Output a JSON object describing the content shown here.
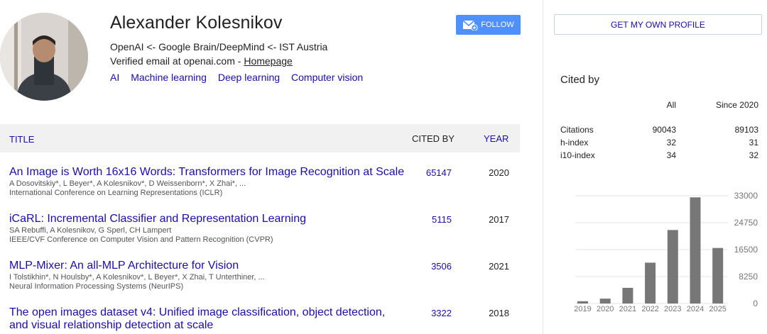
{
  "profile": {
    "name": "Alexander Kolesnikov",
    "affiliation": "OpenAI <- Google Brain/DeepMind <- IST Austria",
    "email_prefix": "Verified email at openai.com - ",
    "homepage_label": "Homepage",
    "interests": [
      "AI",
      "Machine learning",
      "Deep learning",
      "Computer vision"
    ],
    "follow_label": "FOLLOW"
  },
  "table": {
    "headers": {
      "title": "TITLE",
      "cited_by": "CITED BY",
      "year": "YEAR"
    },
    "rows": [
      {
        "title": "An Image is Worth 16x16 Words: Transformers for Image Recognition at Scale",
        "authors": "A Dosovitskiy*, L Beyer*, A Kolesnikov*, D Weissenborn*, X Zhai*, ...",
        "venue": "International Conference on Learning Representations (ICLR)",
        "cited_by": "65147",
        "year": "2020"
      },
      {
        "title": "iCaRL: Incremental Classifier and Representation Learning",
        "authors": "SA Rebuffi, A Kolesnikov, G Sperl, CH Lampert",
        "venue": "IEEE/CVF Conference on Computer Vision and Pattern Recognition (CVPR)",
        "cited_by": "5115",
        "year": "2017"
      },
      {
        "title": "MLP-Mixer: An all-MLP Architecture for Vision",
        "authors": "I Tolstikhin*, N Houlsby*, A Kolesnikov*, L Beyer*, X Zhai, T Unterthiner, ...",
        "venue": "Neural Information Processing Systems (NeurIPS)",
        "cited_by": "3506",
        "year": "2021"
      },
      {
        "title": "The open images dataset v4: Unified image classification, object detection, and visual relationship detection at scale",
        "authors": "",
        "venue": "",
        "cited_by": "3322",
        "year": "2018"
      }
    ]
  },
  "sidebar": {
    "own_profile_label": "GET MY OWN PROFILE",
    "cited_by_title": "Cited by",
    "col_all": "All",
    "col_since": "Since 2020",
    "stats": [
      {
        "label": "Citations",
        "all": "90043",
        "since": "89103"
      },
      {
        "label": "h-index",
        "all": "32",
        "since": "31"
      },
      {
        "label": "i10-index",
        "all": "34",
        "since": "32"
      }
    ]
  },
  "chart_data": {
    "type": "bar",
    "categories": [
      "2019",
      "2020",
      "2021",
      "2022",
      "2023",
      "2024",
      "2025"
    ],
    "values": [
      700,
      1500,
      4800,
      12500,
      22500,
      32500,
      17000
    ],
    "y_ticks": [
      "0",
      "8250",
      "16500",
      "24750",
      "33000"
    ],
    "ylim": [
      0,
      33000
    ],
    "bar_color": "#777777",
    "grid": true
  }
}
